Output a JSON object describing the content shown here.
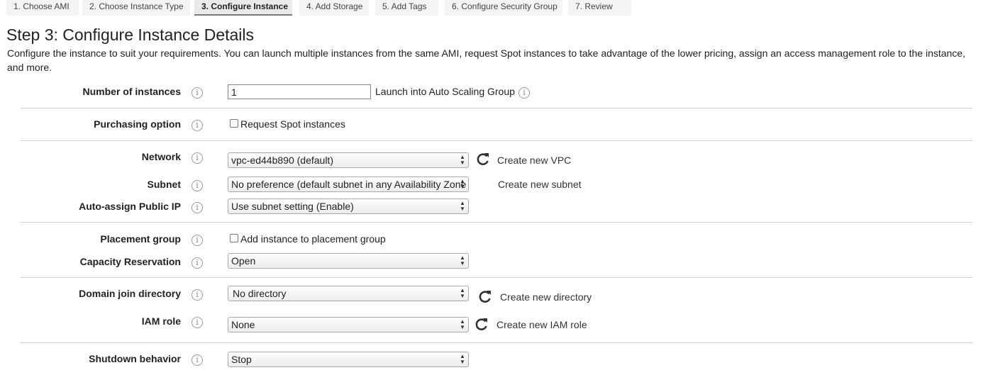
{
  "wizard": {
    "tabs": [
      {
        "label": "1. Choose AMI",
        "active": false
      },
      {
        "label": "2. Choose Instance Type",
        "active": false
      },
      {
        "label": "3. Configure Instance",
        "active": true
      },
      {
        "label": "4. Add Storage",
        "active": false
      },
      {
        "label": "5. Add Tags",
        "active": false
      },
      {
        "label": "6. Configure Security Group",
        "active": false
      },
      {
        "label": "7. Review",
        "active": false
      }
    ]
  },
  "page": {
    "title": "Step 3: Configure Instance Details",
    "description": "Configure the instance to suit your requirements. You can launch multiple instances from the same AMI, request Spot instances to take advantage of the lower pricing, assign an access management role to the instance, and more."
  },
  "info_icon": "i",
  "form": {
    "number_of_instances": {
      "label": "Number of instances",
      "value": "1",
      "extra_text": "Launch into Auto Scaling Group"
    },
    "purchasing_option": {
      "label": "Purchasing option",
      "checkbox_label": "Request Spot instances",
      "checked": false
    },
    "network": {
      "label": "Network",
      "selected": "vpc-ed44b890 (default)",
      "link": "Create new VPC"
    },
    "subnet": {
      "label": "Subnet",
      "selected": "No preference (default subnet in any Availability Zone",
      "link": "Create new subnet"
    },
    "auto_assign_ip": {
      "label": "Auto-assign Public IP",
      "selected": "Use subnet setting (Enable)"
    },
    "placement_group": {
      "label": "Placement group",
      "checkbox_label": "Add instance to placement group",
      "checked": false
    },
    "capacity_reservation": {
      "label": "Capacity Reservation",
      "selected": "Open"
    },
    "domain_join": {
      "label": "Domain join directory",
      "selected": "No directory",
      "link": "Create new directory"
    },
    "iam_role": {
      "label": "IAM role",
      "selected": "None",
      "link": "Create new IAM role"
    },
    "shutdown_behavior": {
      "label": "Shutdown behavior",
      "selected": "Stop"
    }
  },
  "icons": {
    "info": "info-icon",
    "refresh": "refresh-icon",
    "select_arrows": "select-arrows-icon"
  }
}
